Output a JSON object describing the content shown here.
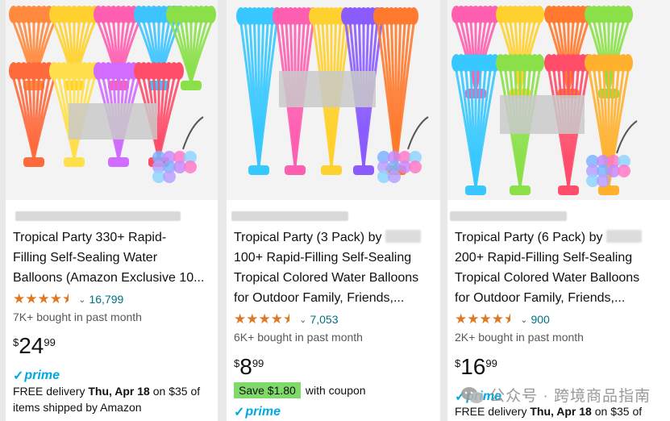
{
  "products": [
    {
      "title_lines": [
        "Tropical Party 330+ Rapid-",
        "Filling Self-Sealing Water",
        "Balloons (Amazon Exclusive 10..."
      ],
      "rating_count": "16,799",
      "bought": "7K+ bought in past month",
      "price": {
        "symbol": "$",
        "whole": "24",
        "fraction": "99"
      },
      "prime_label": "prime",
      "delivery_prefix": "FREE delivery ",
      "delivery_date": "Thu, Apr 18",
      "delivery_suffix": " on $35 of items shipped by Amazon"
    },
    {
      "title_lines": [
        "Tropical Party (3 Pack) by",
        "100+ Rapid-Filling Self-Sealing",
        "Tropical Colored Water Balloons",
        "for Outdoor Family, Friends,..."
      ],
      "rating_count": "7,053",
      "bought": "6K+ bought in past month",
      "price": {
        "symbol": "$",
        "whole": "8",
        "fraction": "99"
      },
      "coupon_badge": "Save $1.80",
      "coupon_text": "with coupon",
      "prime_label": "prime"
    },
    {
      "title_lines": [
        "Tropical Party (6 Pack) by",
        "200+ Rapid-Filling Self-Sealing",
        "Tropical Colored Water Balloons",
        "for Outdoor Family, Friends,..."
      ],
      "rating_count": "900",
      "bought": "2K+ bought in past month",
      "price": {
        "symbol": "$",
        "whole": "16",
        "fraction": "99"
      },
      "prime_label": "prime",
      "delivery_prefix": "FREE delivery ",
      "delivery_date": "Thu, Apr 18",
      "delivery_suffix": " on $35 of"
    }
  ],
  "watermark": "公众号 · 跨境商品指南",
  "colors": {
    "star": "#de7921",
    "link": "#007185",
    "prime": "#00a8e1",
    "coupon": "#7fda69"
  },
  "icons": [
    "star-icon",
    "chevron-down-icon",
    "prime-check-icon",
    "wechat-icon"
  ]
}
